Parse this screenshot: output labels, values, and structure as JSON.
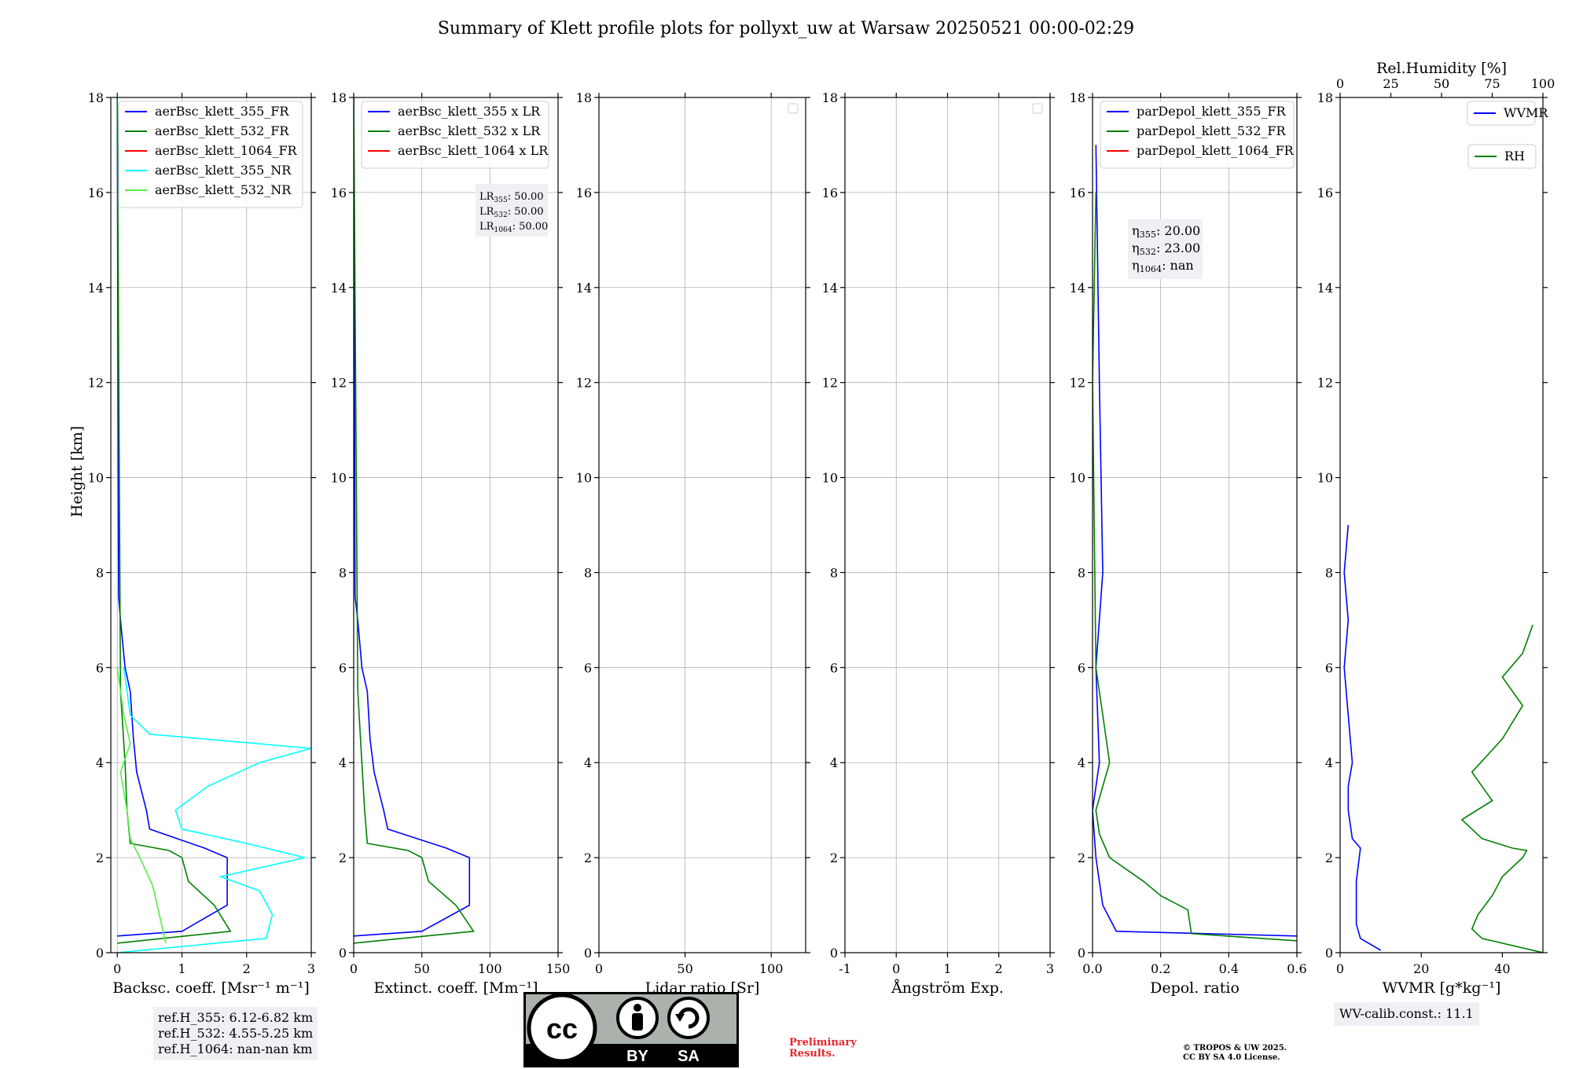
{
  "title": "Summary of Klett profile plots for pollyxt_uw at Warsaw 20250521 00:00-02:29",
  "y_axis_label": "Height [km]",
  "chart_data": [
    {
      "type": "line",
      "xlabel": "Backsc. coeff. [Msr⁻¹ m⁻¹]",
      "xlim": [
        -0.1,
        3
      ],
      "xticks": [
        0,
        1,
        2,
        3
      ],
      "ylim": [
        0,
        18
      ],
      "yticks": [
        0,
        2,
        4,
        6,
        8,
        10,
        12,
        14,
        16,
        18
      ],
      "grid": true,
      "legend": "top-left",
      "series": [
        {
          "name": "aerBsc_klett_355_FR",
          "color": "#0000ff",
          "x": [
            0.0,
            1.0,
            1.7,
            1.7,
            1.35,
            0.5,
            0.45,
            0.3,
            0.25,
            0.2,
            0.12,
            0.05,
            0.02,
            0.0
          ],
          "y": [
            0.35,
            0.45,
            1.0,
            2.0,
            2.2,
            2.6,
            3.0,
            3.8,
            4.5,
            5.5,
            6.0,
            7.0,
            7.5,
            18
          ]
        },
        {
          "name": "aerBsc_klett_532_FR",
          "color": "#008000",
          "x": [
            0.0,
            1.75,
            1.5,
            1.1,
            1.0,
            0.8,
            0.2,
            0.15,
            0.12,
            0.05,
            0.0
          ],
          "y": [
            0.2,
            0.45,
            1.0,
            1.5,
            2.0,
            2.15,
            2.3,
            3.0,
            4.0,
            5.5,
            18
          ]
        },
        {
          "name": "aerBsc_klett_1064_FR",
          "color": "#ff0000",
          "x": [],
          "y": []
        },
        {
          "name": "aerBsc_klett_355_NR",
          "color": "#00ffff",
          "x": [
            0.0,
            2.3,
            2.4,
            2.2,
            1.6,
            2.9,
            2.0,
            1.0,
            0.9,
            1.4,
            2.2,
            3.0,
            0.5,
            0.2,
            0.1
          ],
          "y": [
            0.0,
            0.3,
            0.8,
            1.3,
            1.6,
            2.0,
            2.3,
            2.6,
            3.0,
            3.5,
            4.0,
            4.3,
            4.6,
            5.0,
            6.0
          ]
        },
        {
          "name": "aerBsc_klett_532_NR",
          "color": "#55ee44",
          "x": [
            0.75,
            0.65,
            0.55,
            0.35,
            0.2,
            0.15,
            0.05,
            0.2,
            0.1,
            0.0
          ],
          "y": [
            0.2,
            0.8,
            1.4,
            2.0,
            2.4,
            3.0,
            3.8,
            4.4,
            5.0,
            6.0
          ]
        }
      ]
    },
    {
      "type": "line",
      "xlabel": "Extinct. coeff. [Mm⁻¹]",
      "xlim": [
        0,
        150
      ],
      "xticks": [
        0,
        50,
        100,
        150
      ],
      "ylim": [
        0,
        18
      ],
      "grid": true,
      "legend": "top-left",
      "annotation": [
        "LR355: 50.00",
        "LR532: 50.00",
        "LR1064: 50.00"
      ],
      "series": [
        {
          "name": "aerBsc_klett_355 x LR",
          "color": "#0000ff",
          "x": [
            0,
            50,
            85,
            85,
            68,
            25,
            22,
            15,
            12,
            10,
            6,
            3,
            1,
            0
          ],
          "y": [
            0.35,
            0.45,
            1.0,
            2.0,
            2.2,
            2.6,
            3.0,
            3.8,
            4.5,
            5.5,
            6.0,
            7.0,
            7.5,
            18
          ]
        },
        {
          "name": "aerBsc_klett_532 x LR",
          "color": "#008000",
          "x": [
            0,
            88,
            75,
            55,
            50,
            40,
            10,
            8,
            6,
            3,
            0
          ],
          "y": [
            0.2,
            0.45,
            1.0,
            1.5,
            2.0,
            2.15,
            2.3,
            3.0,
            4.0,
            5.5,
            18
          ]
        },
        {
          "name": "aerBsc_klett_1064 x LR",
          "color": "#ff0000",
          "x": [],
          "y": []
        }
      ]
    },
    {
      "type": "line",
      "xlabel": "Lidar ratio [Sr]",
      "xlim": [
        0,
        120
      ],
      "xticks": [
        0,
        50,
        100
      ],
      "ylim": [
        0,
        18
      ],
      "grid": true,
      "series": []
    },
    {
      "type": "line",
      "xlabel": "Ångström Exp.",
      "xlim": [
        -1,
        3
      ],
      "xticks": [
        -1,
        0,
        1,
        2,
        3
      ],
      "ylim": [
        0,
        18
      ],
      "grid": true,
      "series": []
    },
    {
      "type": "line",
      "xlabel": "Depol. ratio",
      "xlim": [
        0,
        0.6
      ],
      "xticks": [
        0.0,
        0.2,
        0.4,
        0.6
      ],
      "ylim": [
        0,
        18
      ],
      "grid": true,
      "legend": "top-left",
      "annotation": [
        "η355: 20.00",
        "η532: 23.00",
        "η1064: nan"
      ],
      "series": [
        {
          "name": "parDepol_klett_355_FR",
          "color": "#0000ff",
          "x": [
            0.6,
            0.07,
            0.03,
            0.01,
            0.0,
            0.02,
            0.01,
            0.03,
            0.02,
            0.01
          ],
          "y": [
            0.35,
            0.45,
            1.0,
            2.0,
            3.0,
            4.0,
            6.0,
            8.0,
            12.0,
            17.0
          ]
        },
        {
          "name": "parDepol_klett_532_FR",
          "color": "#008000",
          "x": [
            0.6,
            0.29,
            0.28,
            0.2,
            0.15,
            0.05,
            0.02,
            0.01,
            0.05,
            0.01,
            0.0,
            0.01
          ],
          "y": [
            0.25,
            0.4,
            0.9,
            1.2,
            1.5,
            2.0,
            2.5,
            3.0,
            4.0,
            6.0,
            12.0,
            16.0
          ]
        },
        {
          "name": "parDepol_klett_1064_FR",
          "color": "#ff0000",
          "x": [],
          "y": []
        }
      ]
    },
    {
      "type": "line",
      "xlabel": "WVMR [g*kg⁻¹]",
      "xlim": [
        0,
        50
      ],
      "xticks": [
        0,
        20,
        40
      ],
      "ylim": [
        0,
        18
      ],
      "grid": false,
      "legend": "top-right",
      "top_axis": {
        "label": "Rel.Humidity [%]",
        "xlim": [
          0,
          100
        ],
        "xticks": [
          0,
          25,
          50,
          75,
          100
        ]
      },
      "series": [
        {
          "name": "WVMR",
          "color": "#0000ff",
          "x": [
            10,
            5,
            4,
            4,
            5,
            3,
            2,
            2,
            3,
            2,
            1,
            2,
            1,
            2
          ],
          "y": [
            0.05,
            0.3,
            0.6,
            1.5,
            2.2,
            2.4,
            3.0,
            3.5,
            4.0,
            5.0,
            6.0,
            7.0,
            8.0,
            9.0
          ]
        },
        {
          "name": "RH",
          "color": "#008000",
          "x": [
            100,
            70,
            65,
            68,
            75,
            80,
            90,
            92,
            85,
            70,
            60,
            75,
            65,
            80,
            90,
            80,
            90,
            95
          ],
          "y": [
            0.0,
            0.3,
            0.5,
            0.8,
            1.2,
            1.6,
            2.0,
            2.15,
            2.2,
            2.4,
            2.8,
            3.2,
            3.8,
            4.5,
            5.2,
            5.8,
            6.3,
            6.9
          ]
        }
      ]
    }
  ],
  "ref_heights": [
    "ref.H_355: 6.12-6.82 km",
    "ref.H_532: 4.55-5.25 km",
    "ref.H_1064: nan-nan km"
  ],
  "wv_calib": "WV-calib.const.: 11.1",
  "cc_logo": {
    "mark": "cc",
    "by": "BY",
    "sa": "SA"
  },
  "preliminary": [
    "Preliminary",
    "Results."
  ],
  "copyright": [
    "© TROPOS & UW 2025.",
    "CC BY SA 4.0 License."
  ]
}
